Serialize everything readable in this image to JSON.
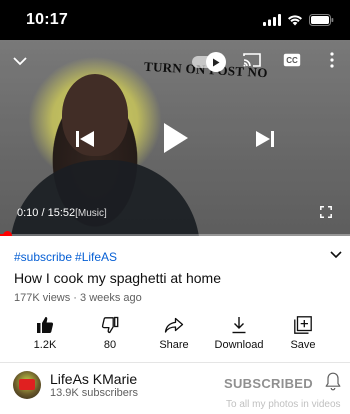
{
  "status_bar": {
    "time": "10:17"
  },
  "player": {
    "overlay_text": "TURN ON POST NO",
    "current_time": "0:10",
    "separator": " / ",
    "duration": "15:52",
    "chapter": "[Music]",
    "progress": 0.0105
  },
  "video": {
    "hashtags": [
      "#subscribe",
      "#LifeAS"
    ],
    "title": "How I cook my spaghetti at home",
    "meta": "177K views · 3 weeks ago"
  },
  "actions": {
    "like": "1.2K",
    "dislike": "80",
    "share": "Share",
    "download": "Download",
    "save": "Save"
  },
  "channel": {
    "name": "LifeAs KMarie",
    "subscribers": "13.9K subscribers",
    "subscribe_label": "SUBSCRIBED",
    "watermark": "To all my photos in videos"
  },
  "colors": {
    "accent": "#ff0000",
    "link": "#065fd4"
  },
  "icons": [
    "signal-icon",
    "wifi-icon",
    "battery-icon",
    "chevron-down-icon",
    "autoplay-icon",
    "cast-icon",
    "cc-icon",
    "more-vertical-icon",
    "skip-previous-icon",
    "play-icon",
    "skip-next-icon",
    "fullscreen-icon",
    "thumbs-up-icon",
    "thumbs-down-icon",
    "share-icon",
    "download-icon",
    "save-playlist-icon",
    "bell-icon"
  ]
}
